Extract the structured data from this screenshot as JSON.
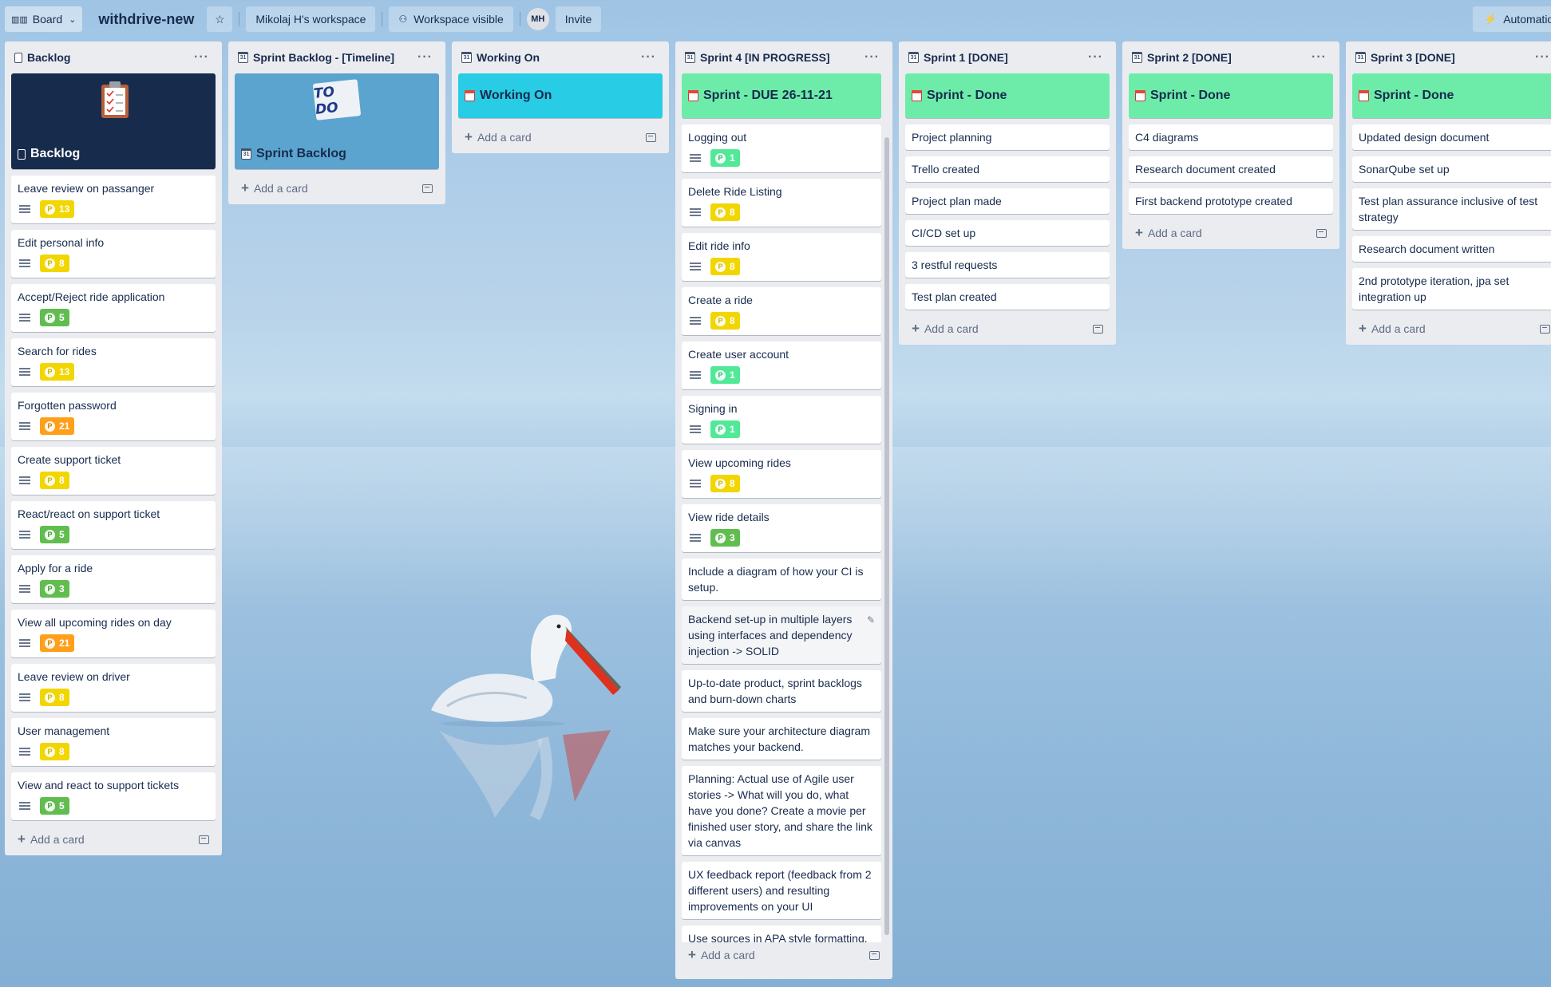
{
  "header": {
    "view_label": "Board",
    "board_title": "withdrive-new",
    "workspace_label": "Mikolaj H's workspace",
    "visibility_label": "Workspace visible",
    "avatar_initials": "MH",
    "invite_label": "Invite",
    "automation_label": "Automation"
  },
  "lists": {
    "backlog": {
      "title": "Backlog",
      "cover_title": "Backlog",
      "cards": [
        {
          "title": "Leave review on passanger",
          "points": "13"
        },
        {
          "title": "Edit personal info",
          "points": "8"
        },
        {
          "title": "Accept/Reject ride application",
          "points": "5"
        },
        {
          "title": "Search for rides",
          "points": "13"
        },
        {
          "title": "Forgotten password",
          "points": "21"
        },
        {
          "title": "Create support ticket",
          "points": "8"
        },
        {
          "title": "React/react on support ticket",
          "points": "5"
        },
        {
          "title": "Apply for a ride",
          "points": "3"
        },
        {
          "title": "View all upcoming rides on day",
          "points": "21"
        },
        {
          "title": "Leave review on driver",
          "points": "8"
        },
        {
          "title": "User management",
          "points": "8"
        },
        {
          "title": "View and react to support tickets",
          "points": "5"
        }
      ],
      "add_card": "Add a card"
    },
    "sprint_backlog": {
      "title": "Sprint Backlog - [Timeline]",
      "cover_title": "Sprint Backlog",
      "cover_sticker": "TO DO",
      "add_card": "Add a card"
    },
    "working_on": {
      "title": "Working On",
      "cover_title": "Working On",
      "add_card": "Add a card"
    },
    "sprint4": {
      "title": "Sprint 4 [IN PROGRESS]",
      "cover_title": "Sprint - DUE 26-11-21",
      "cards": [
        {
          "title": "Logging out",
          "points": "1"
        },
        {
          "title": "Delete Ride Listing",
          "points": "8"
        },
        {
          "title": "Edit ride info",
          "points": "8"
        },
        {
          "title": "Create a ride",
          "points": "8"
        },
        {
          "title": "Create user account",
          "points": "1"
        },
        {
          "title": "Signing in",
          "points": "1"
        },
        {
          "title": "View upcoming rides",
          "points": "8"
        },
        {
          "title": "View ride details",
          "points": "3"
        }
      ],
      "text_cards": [
        "Include a diagram of how your CI is setup.",
        "Backend set-up in multiple layers using interfaces and dependency injection -> SOLID",
        "Up-to-date product, sprint backlogs and burn-down charts",
        "Make sure your architecture diagram matches your backend.",
        "Planning: Actual use of Agile user stories -> What will you do, what have you done? Create a movie per finished user story, and share the link via canvas",
        "UX feedback report (feedback from 2 different users) and resulting improvements on your UI",
        "Use sources in APA style formatting."
      ],
      "add_card": "Add a card"
    },
    "sprint1": {
      "title": "Sprint 1 [DONE]",
      "cover_title": "Sprint - Done",
      "cards": [
        "Project planning",
        "Trello created",
        "Project plan made",
        "CI/CD set up",
        "3 restful requests",
        "Test plan created"
      ],
      "add_card": "Add a card"
    },
    "sprint2": {
      "title": "Sprint 2 [DONE]",
      "cover_title": "Sprint - Done",
      "cards": [
        "C4 diagrams",
        "Research document created",
        "First backend prototype created"
      ],
      "add_card": "Add a card"
    },
    "sprint3": {
      "title": "Sprint 3 [DONE]",
      "cover_title": "Sprint - Done",
      "cards": [
        "Updated design document",
        "SonarQube set up",
        "Test plan assurance inclusive of test strategy",
        "Research document written",
        "2nd prototype iteration, jpa set integration up"
      ],
      "add_card": "Add a card"
    }
  },
  "colors": {
    "yellow": "#f2d600",
    "green": "#61bd4f",
    "lightgreen": "#51e898",
    "orange": "#ff9f1a",
    "cover_navy": "#172b4d",
    "cover_blue": "#5ba4cf",
    "cover_cyan": "#29cce5",
    "cover_green": "#6deca9"
  }
}
